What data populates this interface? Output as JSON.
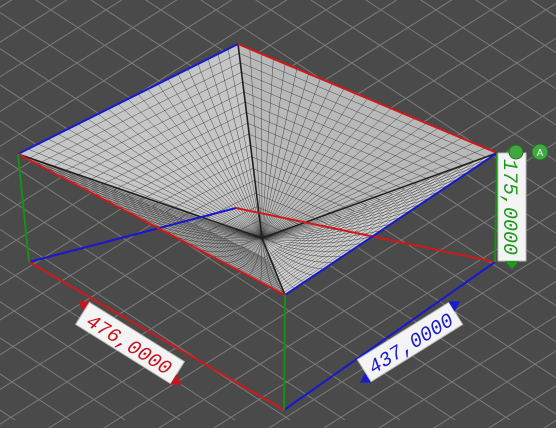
{
  "viewport": {
    "background": "#4a4a4a",
    "grid_color": "#7a7a7a",
    "mesh_fill": "#c9c9c9",
    "mesh_line": "#2a2a2a"
  },
  "dimensions": {
    "length": {
      "value": "476,0000",
      "color": "#c8141e"
    },
    "width": {
      "value": "437,0000",
      "color": "#1a1ad0"
    },
    "height": {
      "value": "175,0000",
      "color": "#1d9a1d"
    }
  },
  "axes": {
    "x_color": "#d01818",
    "y_color": "#1818d0",
    "z_color": "#159015"
  },
  "corner_badge": {
    "label": "A",
    "color": "#3fa83f"
  }
}
